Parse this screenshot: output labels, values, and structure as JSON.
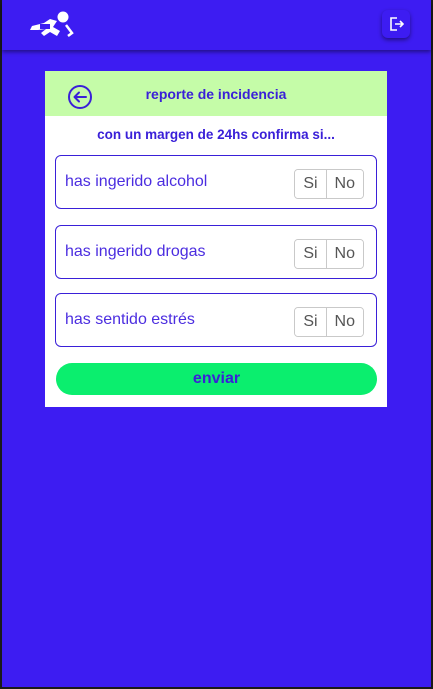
{
  "colors": {
    "background": "#3d1cf2",
    "header_accent": "#c5fca8",
    "primary_text": "#3a20d8",
    "submit_button": "#0bee6e"
  },
  "topbar": {
    "logo_icon": "running-figure-logo-icon",
    "logout_icon": "logout-icon"
  },
  "card": {
    "back_icon": "arrow-left-circle-icon",
    "title": "reporte de incidencia",
    "subtitle": "con un margen de 24hs confirma si...",
    "questions": [
      {
        "label": "has ingerido alcohol",
        "yes": "Si",
        "no": "No"
      },
      {
        "label": "has ingerido drogas",
        "yes": "Si",
        "no": "No"
      },
      {
        "label": "has sentido estrés",
        "yes": "Si",
        "no": "No"
      }
    ],
    "submit_label": "enviar"
  }
}
